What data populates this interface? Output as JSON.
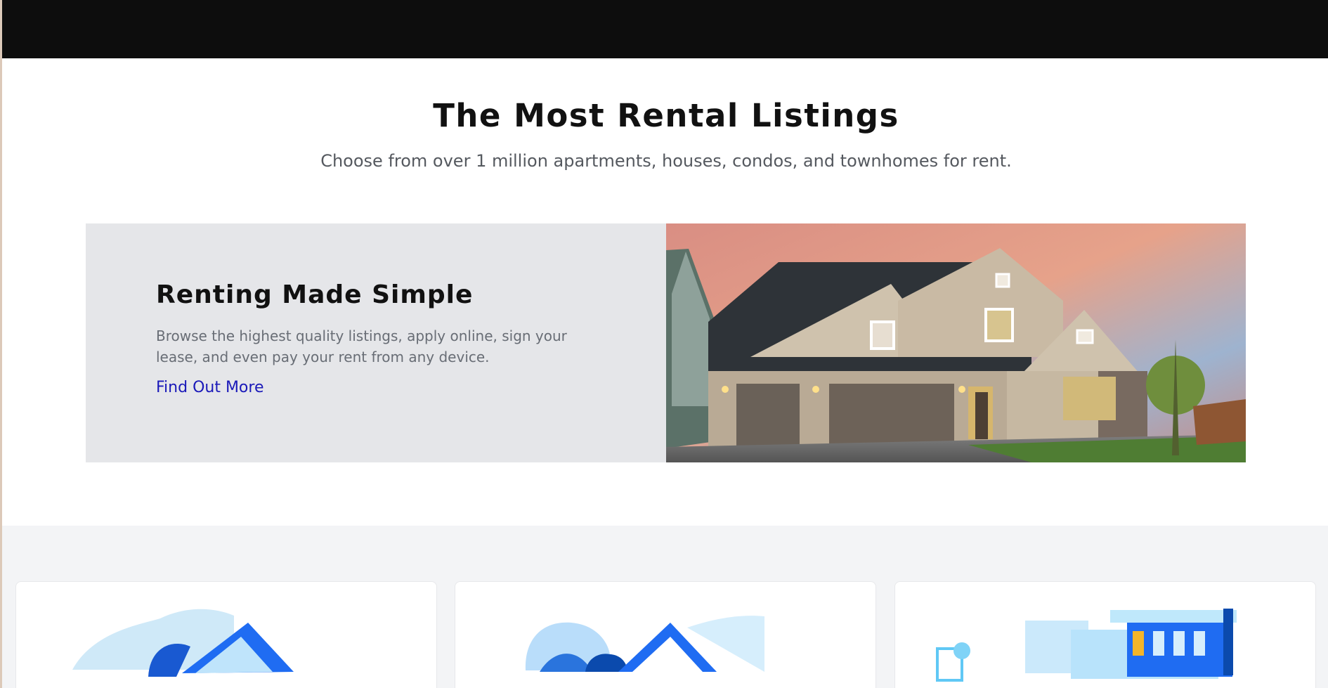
{
  "hero": {
    "title": "The Most Rental Listings",
    "subtitle": "Choose from over 1 million apartments, houses, condos, and townhomes for rent."
  },
  "feature": {
    "title": "Renting Made Simple",
    "description": "Browse the highest quality listings, apply online, sign your lease, and even pay your rent from any device.",
    "link_label": "Find Out More",
    "image_subject": "modern house at sunset"
  },
  "colors": {
    "top_bar": "#0d0d0d",
    "link": "#1a19b9",
    "card_background": "#e5e6e9",
    "section_background": "#f3f4f6",
    "illustration_blue": "#1f6cf2"
  }
}
